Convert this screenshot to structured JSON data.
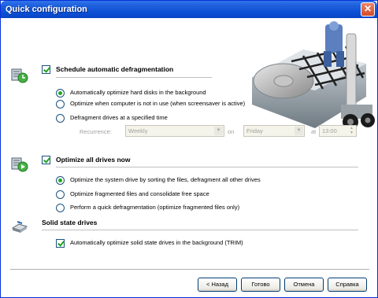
{
  "window": {
    "title": "Quick configuration",
    "close_glyph": "✕"
  },
  "schedule": {
    "title": "Schedule automatic defragmentation",
    "checked": true,
    "options": [
      {
        "label": "Automatically optimize hard disks in the background",
        "selected": true
      },
      {
        "label": "Optimize when computer is not in use (when screensaver is active)",
        "selected": false
      },
      {
        "label": "Defragment drives at a specified time",
        "selected": false
      }
    ],
    "recurrence_label": "Recurrence:",
    "recurrence_value": "Weekly",
    "on_label": "on",
    "day_value": "Friday",
    "at_label": "at",
    "time_value": "13:00"
  },
  "optimize_now": {
    "title": "Optimize all drives now",
    "checked": true,
    "options": [
      {
        "label": "Optimize the system drive by sorting the files, defragment all other drives",
        "selected": true
      },
      {
        "label": "Optimize fragmented files and consolidate free space",
        "selected": false
      },
      {
        "label": "Perform a quick defragmentation (optimize fragmented files only)",
        "selected": false
      }
    ]
  },
  "ssd": {
    "title": "Solid state drives",
    "option": {
      "label": "Automatically optimize solid state drives in the background (TRIM)",
      "checked": true
    }
  },
  "buttons": {
    "back": "< Назад",
    "finish": "Готово",
    "cancel": "Отмена",
    "help": "Справка"
  },
  "colors": {
    "title_bar": "#0a46c4",
    "accent_green": "#22a822",
    "border_blue": "#1c5180"
  }
}
